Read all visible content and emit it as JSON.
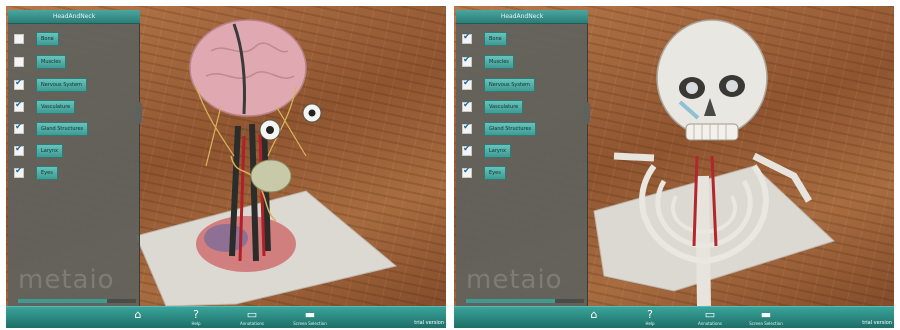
{
  "screens": [
    {
      "panel_title": "HeadAndNeck",
      "layers": [
        {
          "label": "Bone",
          "checked": false
        },
        {
          "label": "Muscles",
          "checked": false
        },
        {
          "label": "Nervous System",
          "checked": true
        },
        {
          "label": "Vasculature",
          "checked": true
        },
        {
          "label": "Gland Structures",
          "checked": true
        },
        {
          "label": "Larynx",
          "checked": true
        },
        {
          "label": "Eyes",
          "checked": true
        }
      ],
      "watermark": "metaio",
      "scroll_fraction": 0.75,
      "toolbar": [
        {
          "icon": "home-icon",
          "label": ""
        },
        {
          "icon": "help-icon",
          "label": "Help"
        },
        {
          "icon": "annotations-icon",
          "label": "Annotations"
        },
        {
          "icon": "screen-selection-icon",
          "label": "Screen Selection"
        }
      ],
      "trial_text": "trial version"
    },
    {
      "panel_title": "HeadAndNeck",
      "layers": [
        {
          "label": "Bone",
          "checked": true
        },
        {
          "label": "Muscles",
          "checked": true
        },
        {
          "label": "Nervous System",
          "checked": true
        },
        {
          "label": "Vasculature",
          "checked": true
        },
        {
          "label": "Gland Structures",
          "checked": true
        },
        {
          "label": "Larynx",
          "checked": true
        },
        {
          "label": "Eyes",
          "checked": true
        }
      ],
      "watermark": "metaio",
      "scroll_fraction": 0.75,
      "toolbar": [
        {
          "icon": "home-icon",
          "label": ""
        },
        {
          "icon": "help-icon",
          "label": "Help"
        },
        {
          "icon": "annotations-icon",
          "label": "Annotations"
        },
        {
          "icon": "screen-selection-icon",
          "label": "Screen Selection"
        }
      ],
      "trial_text": "trial version"
    }
  ],
  "colors": {
    "teal_accent": "#3aa49a",
    "panel_bg": "#60625c",
    "check_color": "#1c6f9a"
  }
}
